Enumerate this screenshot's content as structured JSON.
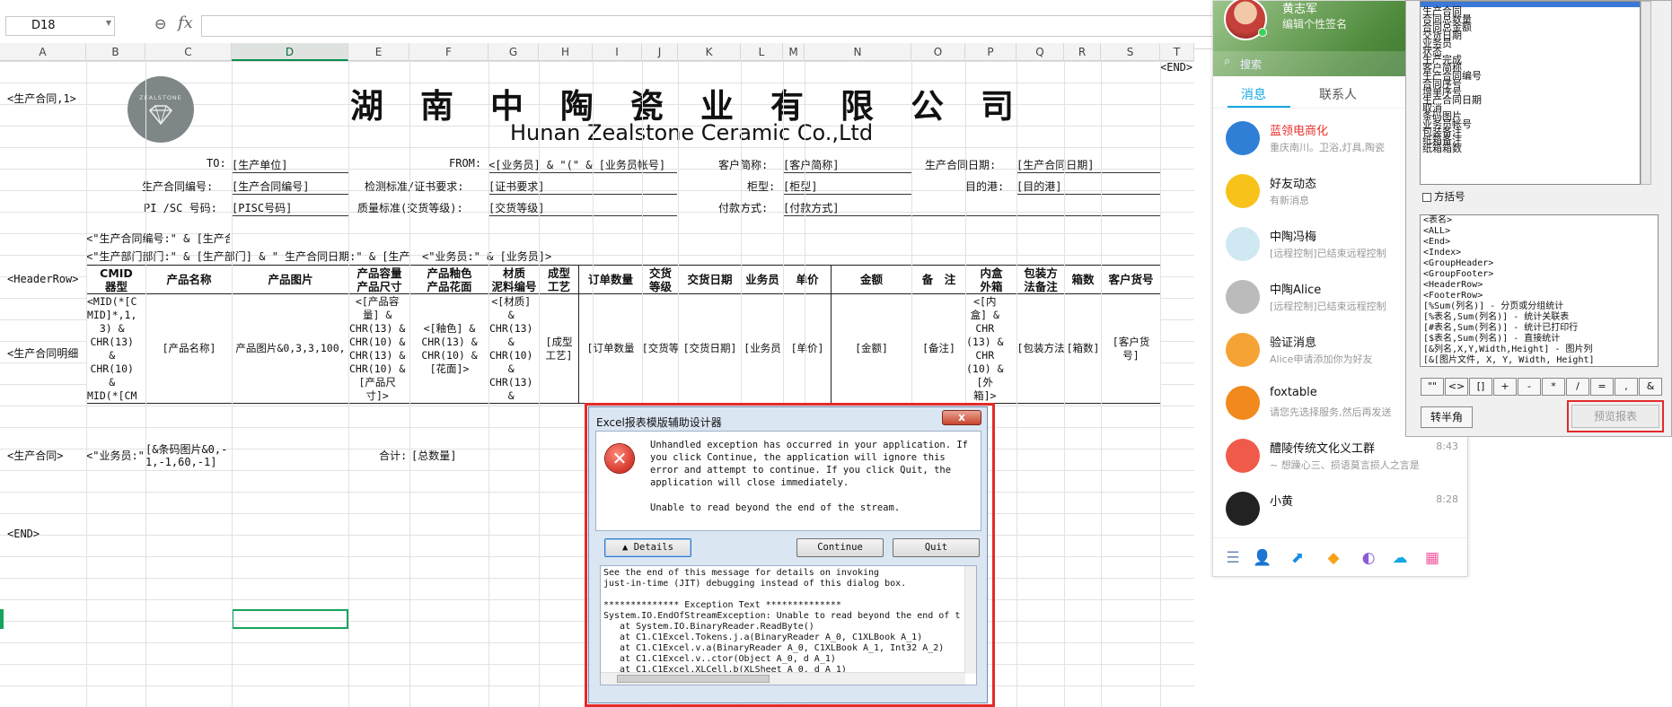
{
  "formula_bar": {
    "name_box": "D18",
    "fx": "fx"
  },
  "columns": [
    "A",
    "B",
    "C",
    "D",
    "E",
    "F",
    "G",
    "H",
    "I",
    "J",
    "K",
    "L",
    "M",
    "N",
    "O",
    "P",
    "Q",
    "R",
    "S",
    "T"
  ],
  "sheet": {
    "title_cn": "湖南中陶瓷业有限公司",
    "title_en": "Hunan Zealstone Ceramic Co.,Ltd",
    "logo_text": "ZEALSTONE",
    "a_contract": "<生产合同,1>",
    "end_top": "<END>",
    "to_label": "TO:",
    "to_value": "[生产单位]",
    "from_label": "FROM:",
    "from_value": "<[业务员] & \"(\" & [业务员帐号]",
    "cust_label": "客户简称:",
    "cust_value": "[客户简称]",
    "date_label": "生产合同日期:",
    "date_value": "[生产合同日期]",
    "no_label": "生产合同编号:",
    "no_value": "[生产合同编号]",
    "cert_label": "检测标准/证书要求:",
    "cert_value": "[证书要求]",
    "cab_label": "柜型:",
    "cab_value": "[柜型]",
    "port_label": "目的港:",
    "port_value": "[目的港]",
    "pi_label": "PI /SC 号码:",
    "pi_value": "[PISC号码]",
    "qual_label": "质量标准(交货等级):",
    "qual_value": "[交货等级]",
    "pay_label": "付款方式:",
    "pay_value": "[付款方式]",
    "f1": "<\"生产合同编号:\" & [生产合同",
    "f2": "<\"生产部门部门:\" & [生产部门] & \"    生产合同日期:\" & [生产",
    "f3": "<\"业务员:\" & [业务员]>",
    "header_row": "<HeaderRow>",
    "detail_row": "<生产合同明细",
    "contract_row": "<生产合同>",
    "end_row": "<END>",
    "headers": [
      "CMID\n器型",
      "产品名称",
      "产品图片",
      "产品容量\n产品尺寸",
      "产品釉色\n产品花面",
      "材质\n泥料编号",
      "成型\n工艺",
      "订单数量",
      "交货\n等级",
      "交货日期",
      "业务员",
      "单价",
      "金额",
      "备　注",
      "内盒\n外箱",
      "包装方\n法备注",
      "箱数",
      "客户货号"
    ],
    "details": [
      "<MID(*[C\nMID]*,1,\n3) &\nCHR(13)\n&\nCHR(10)\n&\nMID(*[CM",
      "[产品名称]",
      "产品图片&0,3,3,100,",
      "<[产品容\n量] &\nCHR(13) &\nCHR(10) &\nCHR(13) &\nCHR(10) &\n[产品尺\n寸]>",
      "<[釉色] &\nCHR(13) &\nCHR(10) &\n[花面]>",
      "<[材质]\n&\nCHR(13)\n&\nCHR(10)\n&\nCHR(13)\n&",
      "[成型\n工艺]",
      "[订单数量",
      "[交货等",
      "[交货日期]",
      "[业务员",
      "[单价]",
      "[金额]",
      "[备注]",
      "<[内\n盒] &\nCHR\n(13) &\nCHR\n(10) &\n[外\n箱]>",
      "[包装方法",
      "[箱数]",
      "[客户货\n号]"
    ],
    "b_contract": "<\"业务员:\"",
    "c_contract": "[&条码图片&0,-\n1,-1,60,-1]",
    "total_label": "合计:",
    "total_value": "[总数量]"
  },
  "dialog": {
    "title": "Excel报表模版辅助设计器",
    "close": "x",
    "message": "Unhandled exception has occurred in your application. If\nyou click Continue, the application will ignore this\nerror and attempt to continue. If you click Quit, the\napplication will close immediately.\n\nUnable to read beyond the end of the stream.",
    "details_btn": "▲ Details",
    "continue_btn": "Continue",
    "quit_btn": "Quit",
    "log": "See the end of this message for details on invoking\njust-in-time (JIT) debugging instead of this dialog box.\n\n************** Exception Text **************\nSystem.IO.EndOfStreamException: Unable to read beyond the end of t\n   at System.IO.BinaryReader.ReadByte()\n   at C1.C1Excel.Tokens.j.a(BinaryReader A_0, C1XLBook A_1)\n   at C1.C1Excel.v.a(BinaryReader A_0, C1XLBook A_1, Int32 A_2)\n   at C1.C1Excel.v..ctor(Object A_0, d A_1)\n   at C1.C1Excel.XLCell.b(XLSheet A_0, d A_1)"
  },
  "qq": {
    "user_name": "黄志军",
    "signature": "编辑个性签名",
    "search": "搜索",
    "tabs": [
      "消息",
      "联系人"
    ],
    "items": [
      {
        "name": "蓝领电商化",
        "desc": "重庆南川。卫浴,灯具,陶瓷",
        "time": "",
        "color": "#2f7fd6",
        "red": true
      },
      {
        "name": "好友动态",
        "desc": "有新消息",
        "time": "",
        "color": "#f7c21a",
        "red": false
      },
      {
        "name": "中陶冯梅",
        "desc": "[远程控制]已结束远程控制",
        "time": "",
        "color": "#cfe8f2",
        "red": false
      },
      {
        "name": "中陶Alice",
        "desc": "[远程控制]已结束远程控制",
        "time": "",
        "color": "#bbbbbb",
        "red": false
      },
      {
        "name": "验证消息",
        "desc": "Alice申请添加你为好友",
        "time": "",
        "color": "#f5a335",
        "red": false
      },
      {
        "name": "foxtable",
        "desc": "请您先选择服务,然后再发送",
        "time": "",
        "color": "#f08a1c",
        "red": false
      },
      {
        "name": "醴陵传统文化义工群",
        "desc": "~ 想躁心三、损语莫言损人之言是",
        "time": "8:43",
        "color": "#f05a4a",
        "red": false
      },
      {
        "name": "小黄",
        "desc": "",
        "time": "8:28",
        "color": "#222222",
        "red": false
      }
    ]
  },
  "designer": {
    "fields": [
      "生产合同",
      "合同总数量",
      "合同总金额",
      "交货日期",
      "业务员",
      "状态",
      "生产完成",
      "客户简称",
      "生产合同编号",
      "合同序号",
      "增单序号",
      "生产合同日期",
      "取消",
      "条码图片",
      "业务员帐号",
      "包装备注",
      "纸箱备注",
      "纸箱箱数"
    ],
    "checkbox": "方括号",
    "template": [
      "<表名>",
      "<ALL>",
      "<End>",
      "<Index>",
      "<GroupHeader>",
      "<GroupFooter>",
      "<HeaderRow>",
      "<FooterRow>",
      "[%Sum(列名)] - 分页或分组统计",
      "[%表名,Sum(列名)] - 统计关联表",
      "[#表名,Sum(列名)] - 统计已打印行",
      "[$表名,Sum(列名)] - 直接统计",
      "[&列名,X,Y,Width,Height] - 图片列",
      "[&[图片文件, X, Y, Width, Height]"
    ],
    "symbols": [
      "\"\"",
      "<>",
      "[]",
      "+",
      "-",
      "*",
      "/",
      "=",
      ",",
      "&"
    ],
    "convert": "转半角",
    "preview": "预览报表"
  }
}
